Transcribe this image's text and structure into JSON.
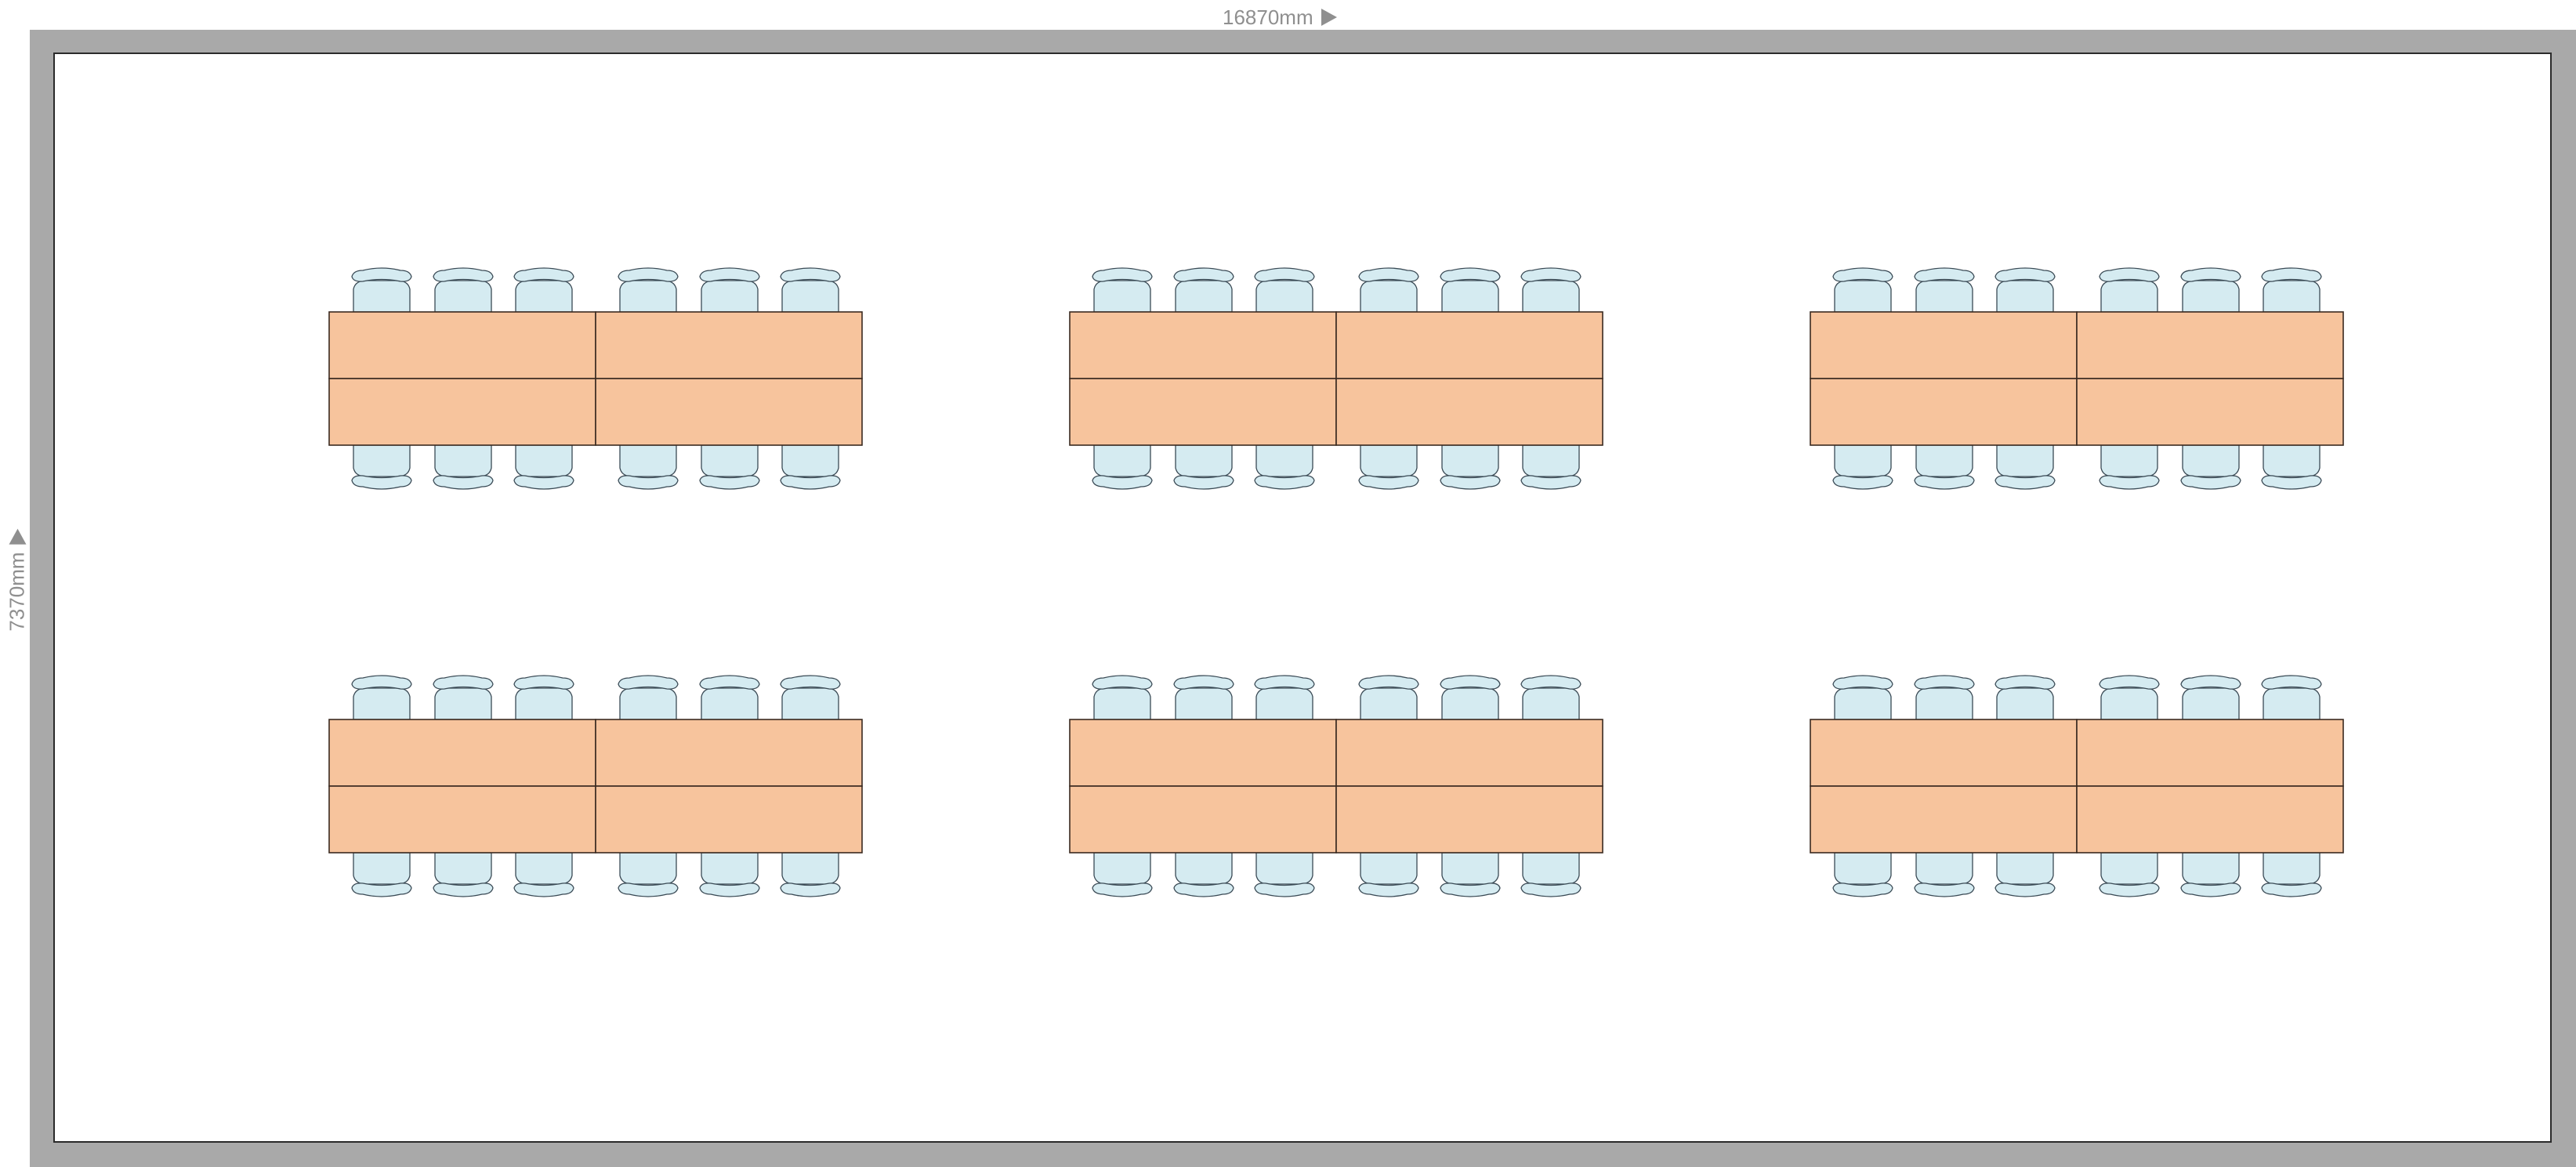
{
  "dimensions": {
    "width_label": "16870mm",
    "height_label": "7370mm",
    "arrow_icon": "triangle-arrow"
  },
  "colors": {
    "wall": "#a9a9a9",
    "floor": "#ffffff",
    "table_fill": "#f7c49d",
    "table_stroke": "#3a2a20",
    "chair_fill": "#d5ebf1",
    "chair_stroke": "#3a4a55",
    "dim_text": "#8f8f8f"
  },
  "layout": {
    "table_groups": 6,
    "rows": 2,
    "columns": 3,
    "tables_per_group": 4,
    "chairs_per_side": 6,
    "total_chairs": 72
  }
}
